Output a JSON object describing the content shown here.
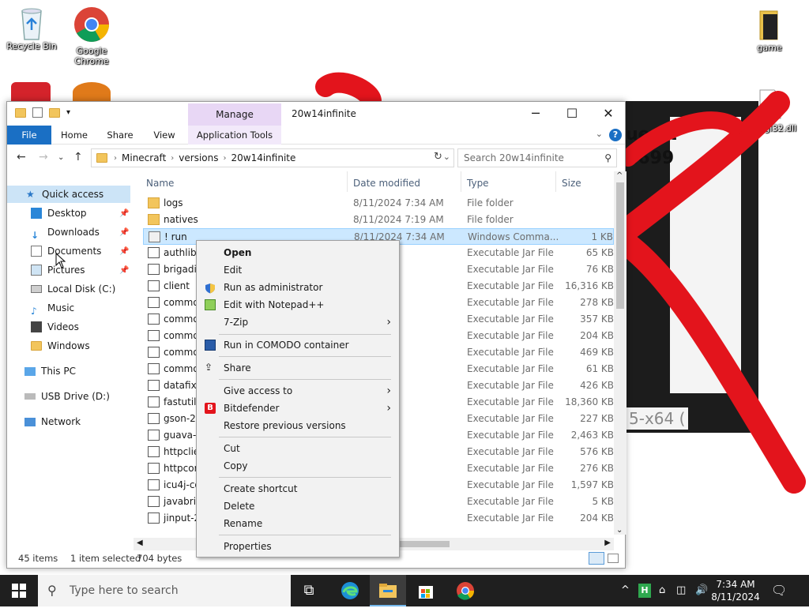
{
  "desktop": {
    "icons": [
      {
        "label": "Recycle Bin"
      },
      {
        "label": "Google Chrome"
      },
      {
        "label": "game"
      },
      {
        "label": "opengl32.dll"
      }
    ],
    "bg_window": {
      "line1": "uestt",
      "line2": "2699",
      "line3": "5-x64 ("
    }
  },
  "explorer": {
    "title": "20w14infinite",
    "manage_tab": "Manage",
    "ribbon_tabs": {
      "file": "File",
      "home": "Home",
      "share": "Share",
      "view": "View",
      "app_tools": "Application Tools"
    },
    "help": "?",
    "breadcrumb": [
      "Minecraft",
      "versions",
      "20w14infinite"
    ],
    "search_placeholder": "Search 20w14infinite",
    "nav": {
      "quick_access": "Quick access",
      "desktop": "Desktop",
      "downloads": "Downloads",
      "documents": "Documents",
      "pictures": "Pictures",
      "local_disk": "Local Disk (C:)",
      "music": "Music",
      "videos": "Videos",
      "windows": "Windows",
      "this_pc": "This PC",
      "usb": "USB Drive (D:)",
      "network": "Network"
    },
    "columns": {
      "name": "Name",
      "date": "Date modified",
      "type": "Type",
      "size": "Size"
    },
    "rows": [
      {
        "name": "logs",
        "date": "8/11/2024 7:34 AM",
        "type": "File folder",
        "size": ""
      },
      {
        "name": "natives",
        "date": "8/11/2024 7:19 AM",
        "type": "File folder",
        "size": ""
      },
      {
        "name": "! run",
        "date": "8/11/2024 7:34 AM",
        "type": "Windows Comma...",
        "size": "1 KB"
      },
      {
        "name": "authlib-",
        "date": "18 AM",
        "type": "Executable Jar File",
        "size": "65 KB"
      },
      {
        "name": "brigadie",
        "date": "18 AM",
        "type": "Executable Jar File",
        "size": "76 KB"
      },
      {
        "name": "client",
        "date": "18 AM",
        "type": "Executable Jar File",
        "size": "16,316 KB"
      },
      {
        "name": "commo",
        "date": "17 AM",
        "type": "Executable Jar File",
        "size": "278 KB"
      },
      {
        "name": "commo",
        "date": "18 AM",
        "type": "Executable Jar File",
        "size": "357 KB"
      },
      {
        "name": "commo",
        "date": "17 AM",
        "type": "Executable Jar File",
        "size": "204 KB"
      },
      {
        "name": "commo",
        "date": "17 AM",
        "type": "Executable Jar File",
        "size": "469 KB"
      },
      {
        "name": "commo",
        "date": "18 AM",
        "type": "Executable Jar File",
        "size": "61 KB"
      },
      {
        "name": "datafixe",
        "date": "18 AM",
        "type": "Executable Jar File",
        "size": "426 KB"
      },
      {
        "name": "fastutil-",
        "date": "18 AM",
        "type": "Executable Jar File",
        "size": "18,360 KB"
      },
      {
        "name": "gson-2.8",
        "date": "18 AM",
        "type": "Executable Jar File",
        "size": "227 KB"
      },
      {
        "name": "guava-2",
        "date": "17 AM",
        "type": "Executable Jar File",
        "size": "2,463 KB"
      },
      {
        "name": "httpclier",
        "date": "18 AM",
        "type": "Executable Jar File",
        "size": "576 KB"
      },
      {
        "name": "httpcore",
        "date": "18 AM",
        "type": "Executable Jar File",
        "size": "276 KB"
      },
      {
        "name": "icu4j-co",
        "date": "18 AM",
        "type": "Executable Jar File",
        "size": "1,597 KB"
      },
      {
        "name": "javabrid",
        "date": "17 AM",
        "type": "Executable Jar File",
        "size": "5 KB"
      },
      {
        "name": "jinput-2",
        "date": "17 AM",
        "type": "Executable Jar File",
        "size": "204 KB"
      }
    ],
    "status": {
      "count": "45 items",
      "selected": "1 item selected",
      "size": "704 bytes"
    }
  },
  "context_menu": {
    "open": "Open",
    "edit": "Edit",
    "run_admin": "Run as administrator",
    "notepad": "Edit with Notepad++",
    "sevenzip": "7-Zip",
    "comodo": "Run in COMODO container",
    "share": "Share",
    "give_access": "Give access to",
    "bitdefender": "Bitdefender",
    "restore": "Restore previous versions",
    "cut": "Cut",
    "copy": "Copy",
    "shortcut": "Create shortcut",
    "delete": "Delete",
    "rename": "Rename",
    "properties": "Properties"
  },
  "taskbar": {
    "search_placeholder": "Type here to search",
    "time": "7:34 AM",
    "date": "8/11/2024"
  }
}
